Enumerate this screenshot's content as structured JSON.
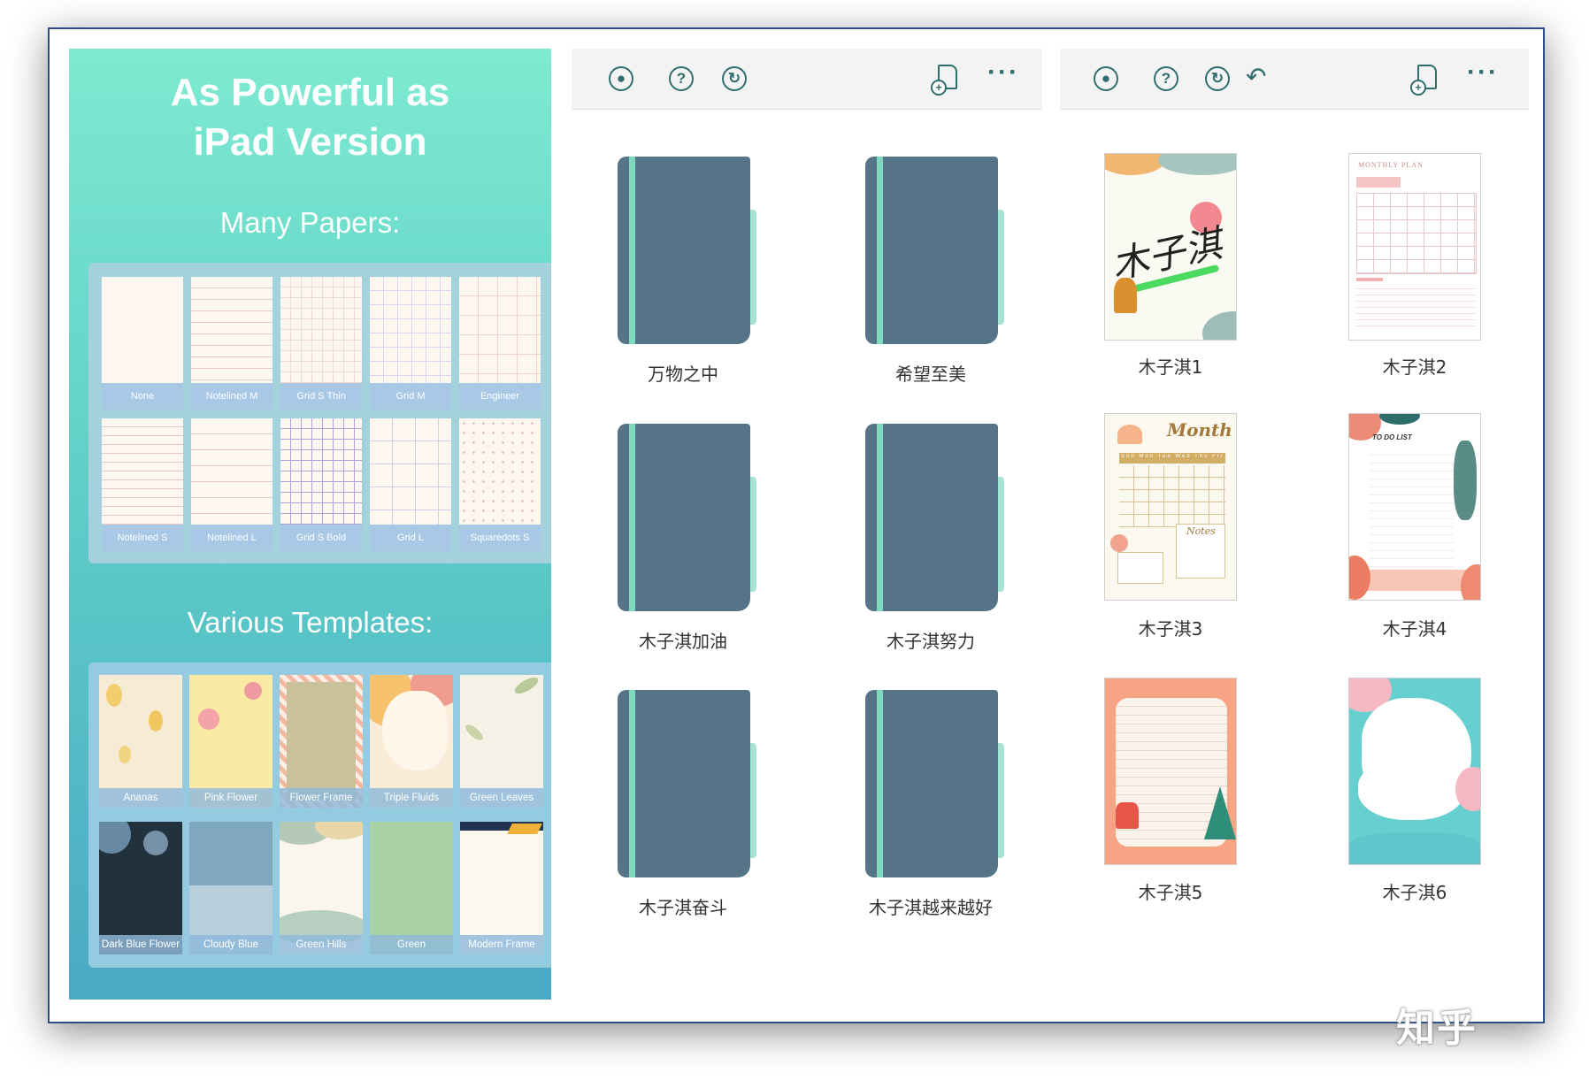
{
  "promo": {
    "title_line1": "As Powerful as",
    "title_line2": "iPad Version",
    "papers_heading": "Many Papers:",
    "templates_heading": "Various Templates:",
    "papers": [
      "None",
      "Notelined M",
      "Grid S Thin",
      "Grid M",
      "Engineer",
      "Notelined S",
      "Notelined L",
      "Grid S Bold",
      "Grid L",
      "Squaredots S"
    ],
    "templates": [
      "Ananas",
      "Pink Flower",
      "Flower Frame",
      "Triple Fluids",
      "Green Leaves",
      "Dark Blue Flower",
      "Cloudy Blue",
      "Green Hills",
      "Green",
      "Modern Frame"
    ]
  },
  "notebooks": {
    "items": [
      "万物之中",
      "希望至美",
      "木子淇加油",
      "木子淇努力",
      "木子淇奋斗",
      "木子淇越来越好"
    ]
  },
  "pages": {
    "items": [
      "木子淇1",
      "木子淇2",
      "木子淇3",
      "木子淇4",
      "木子淇5",
      "木子淇6"
    ],
    "p1_handwriting": "木子淇",
    "p2_heading": "MONTHLY PLAN",
    "p3_heading": "Month",
    "p3_weekdays": "Sun Mon Tue Wed Thu Fri Sat",
    "p3_notes": "Notes",
    "p4_heading": "TO DO LIST"
  },
  "toolbar": {
    "icons": [
      "user-icon",
      "help-icon",
      "sync-icon",
      "undo-icon",
      "new-page-icon",
      "more-icon"
    ]
  },
  "watermark": "知乎"
}
